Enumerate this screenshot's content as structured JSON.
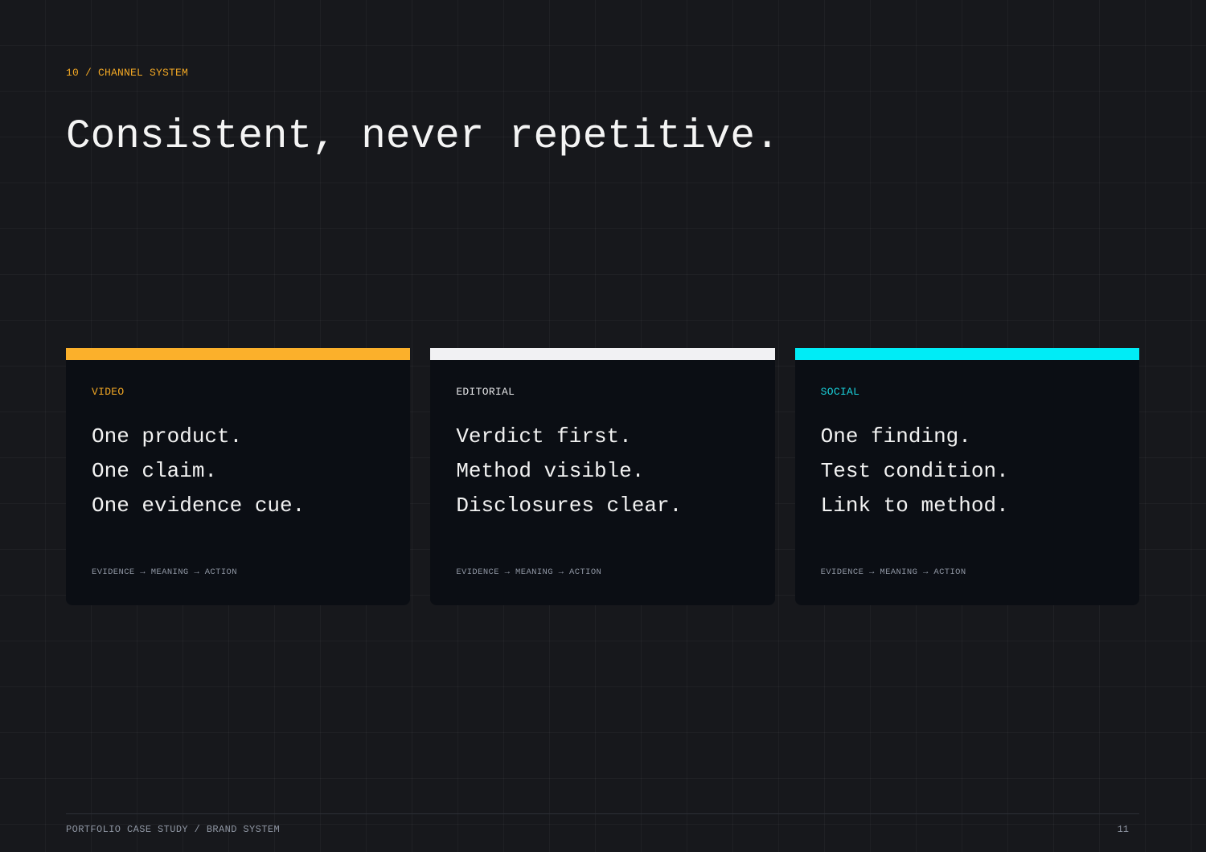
{
  "eyebrow": "10 / CHANNEL SYSTEM",
  "title": "Consistent, never repetitive.",
  "cards": [
    {
      "tag": "VIDEO",
      "accent": "#fbb02b",
      "tag_color": "#f3a824",
      "lines": [
        "One product.",
        "One claim.",
        "One evidence cue."
      ],
      "flow": "EVIDENCE → MEANING → ACTION"
    },
    {
      "tag": "EDITORIAL",
      "accent": "#f1f1f3",
      "tag_color": "#e6e6e8",
      "lines": [
        "Verdict first.",
        "Method visible.",
        "Disclosures clear."
      ],
      "flow": "EVIDENCE → MEANING → ACTION"
    },
    {
      "tag": "SOCIAL",
      "accent": "#00ecf6",
      "tag_color": "#19d3dd",
      "lines": [
        "One finding.",
        "Test condition.",
        "Link to method."
      ],
      "flow": "EVIDENCE → MEANING → ACTION"
    }
  ],
  "footer": {
    "left": "PORTFOLIO CASE STUDY / BRAND SYSTEM",
    "page_number": "11"
  }
}
